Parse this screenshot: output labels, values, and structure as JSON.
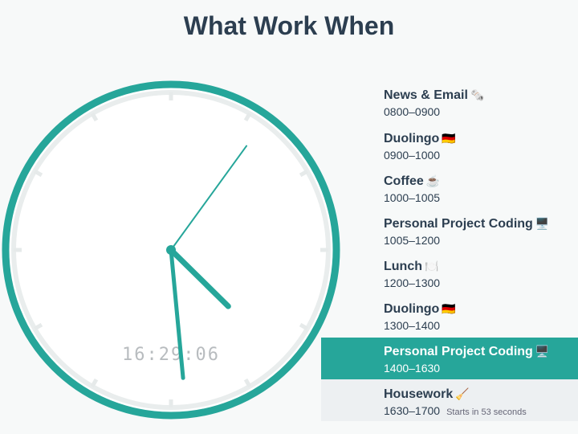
{
  "page": {
    "title": "What Work When"
  },
  "clock": {
    "digital_time": "16:29:06",
    "hours": 16,
    "minutes": 29,
    "seconds": 6,
    "ring_color": "#26a69a",
    "hand_color": "#26a69a"
  },
  "schedule": [
    {
      "name": "News & Email",
      "emoji": "🗞️",
      "time": "0800–0900"
    },
    {
      "name": "Duolingo",
      "emoji": "🇩🇪",
      "time": "0900–1000"
    },
    {
      "name": "Coffee",
      "emoji": "☕",
      "time": "1000–1005"
    },
    {
      "name": "Personal Project Coding",
      "emoji": "🖥️",
      "time": "1005–1200"
    },
    {
      "name": "Lunch",
      "emoji": "🍽️",
      "time": "1200–1300"
    },
    {
      "name": "Duolingo",
      "emoji": "🇩🇪",
      "time": "1300–1400"
    },
    {
      "name": "Personal Project Coding",
      "emoji": "🖥️",
      "time": "1400–1630",
      "current": true
    },
    {
      "name": "Housework",
      "emoji": "🧹",
      "time": "1630–1700",
      "next": true,
      "starts_in": "Starts in 53 seconds"
    }
  ],
  "colors": {
    "accent": "#26a69a",
    "text": "#2c3e50",
    "next_bg": "#edf0f2"
  }
}
